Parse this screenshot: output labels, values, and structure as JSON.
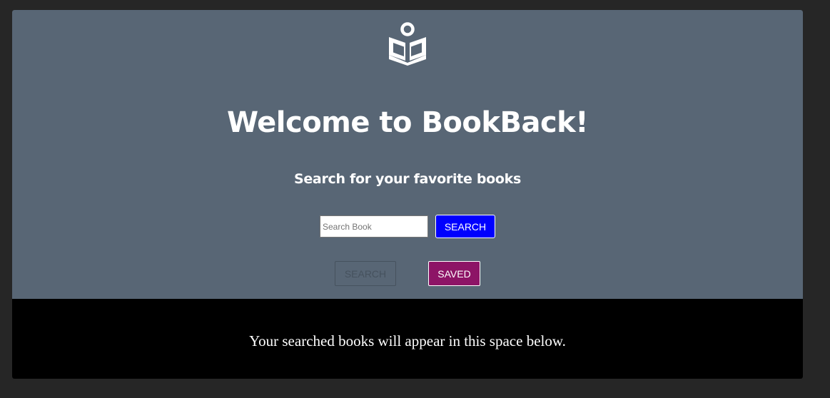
{
  "header": {
    "logo_icon": "reader-book-icon",
    "title": "Welcome to BookBack!",
    "subtitle": "Search for your favorite books"
  },
  "search": {
    "placeholder": "Search Book",
    "value": "",
    "button_label": "SEARCH"
  },
  "nav": {
    "search_label": "SEARCH",
    "saved_label": "SAVED"
  },
  "results": {
    "message": "Your searched books will appear in this space below."
  },
  "colors": {
    "hero_background": "#586675",
    "page_background": "#262626",
    "results_background": "#000000",
    "search_button": "#0000ff",
    "saved_button": "#8d1466"
  }
}
